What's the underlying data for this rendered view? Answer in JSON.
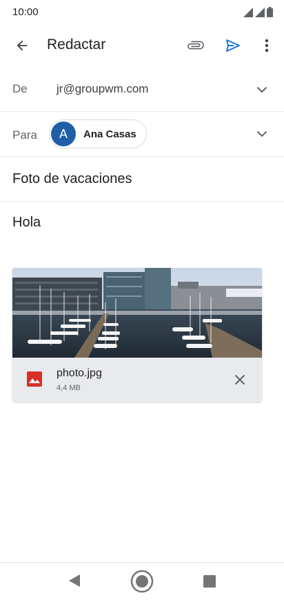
{
  "status_bar": {
    "time": "10:00"
  },
  "toolbar": {
    "title": "Redactar",
    "accent_color": "#1a73e8"
  },
  "from": {
    "label": "De",
    "value": "jr@groupwm.com"
  },
  "to": {
    "label": "Para",
    "recipient_initial": "A",
    "recipient_name": "Ana Casas"
  },
  "subject": {
    "value": "Foto de vacaciones"
  },
  "body": {
    "value": "Hola"
  },
  "attachment": {
    "file_name": "photo.jpg",
    "file_size": "4,4 MB",
    "icon": "image-file-icon",
    "icon_color": "#d93025"
  },
  "nav": {
    "back_icon": "back-triangle-icon",
    "home_icon": "home-circle-icon",
    "recents_icon": "recents-square-icon"
  }
}
